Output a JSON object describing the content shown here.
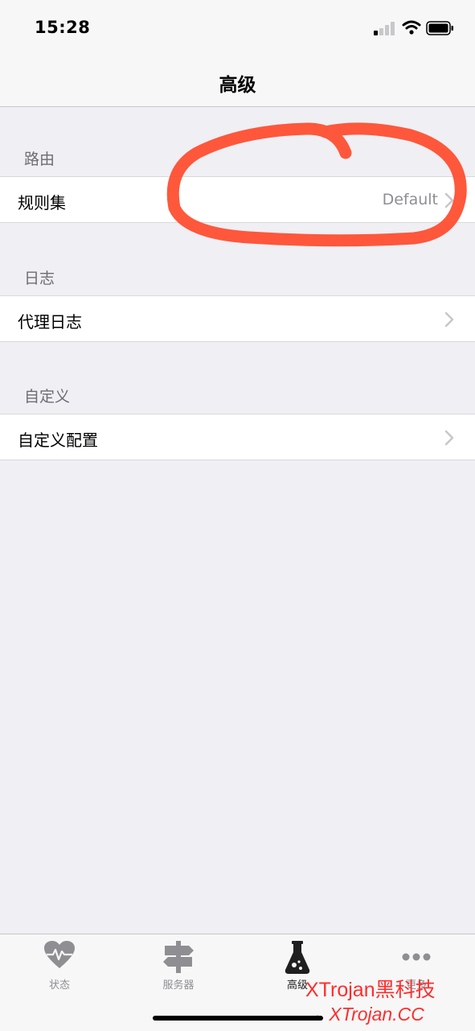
{
  "status_bar": {
    "time": "15:28"
  },
  "nav": {
    "title": "高级"
  },
  "sections": [
    {
      "header": "路由",
      "row": {
        "label": "规则集",
        "value": "Default"
      }
    },
    {
      "header": "日志",
      "row": {
        "label": "代理日志"
      }
    },
    {
      "header": "自定义",
      "row": {
        "label": "自定义配置"
      }
    }
  ],
  "tabs": [
    {
      "label": "状态",
      "icon": "heart-pulse-icon"
    },
    {
      "label": "服务器",
      "icon": "signpost-icon"
    },
    {
      "label": "高级",
      "icon": "flask-icon",
      "active": true
    },
    {
      "label": "更多",
      "icon": "more-dots-icon"
    }
  ],
  "watermark": {
    "line1": "XTrojan黑科技",
    "line2": "→ XTrojan.CC"
  },
  "colors": {
    "annotation": "#ff4a2a",
    "background": "#efeff4",
    "watermark": "#ff2d2d"
  }
}
